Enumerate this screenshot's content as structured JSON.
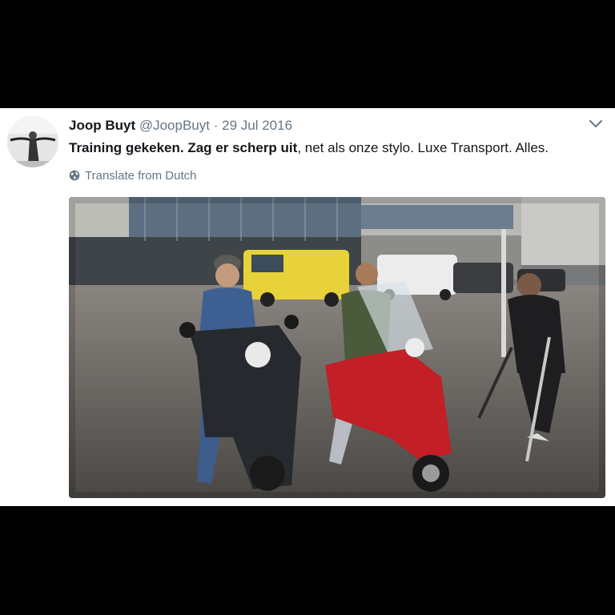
{
  "tweet": {
    "author_name": "Joop Buyt",
    "author_handle": "@JoopBuyt",
    "separator": "·",
    "date": "29 Jul 2016",
    "text_bold": "Training gekeken. Zag er scherp uit",
    "text_rest": ", net als onze stylo. Luxe Transport. Alles.",
    "translate_label": "Translate from Dutch"
  },
  "icons": {
    "avatar": "avatar",
    "menu": "chevron-down-icon",
    "translate": "globe-icon"
  },
  "colors": {
    "name": "#14171a",
    "secondary": "#657786",
    "background": "#000000",
    "card": "#ffffff"
  }
}
